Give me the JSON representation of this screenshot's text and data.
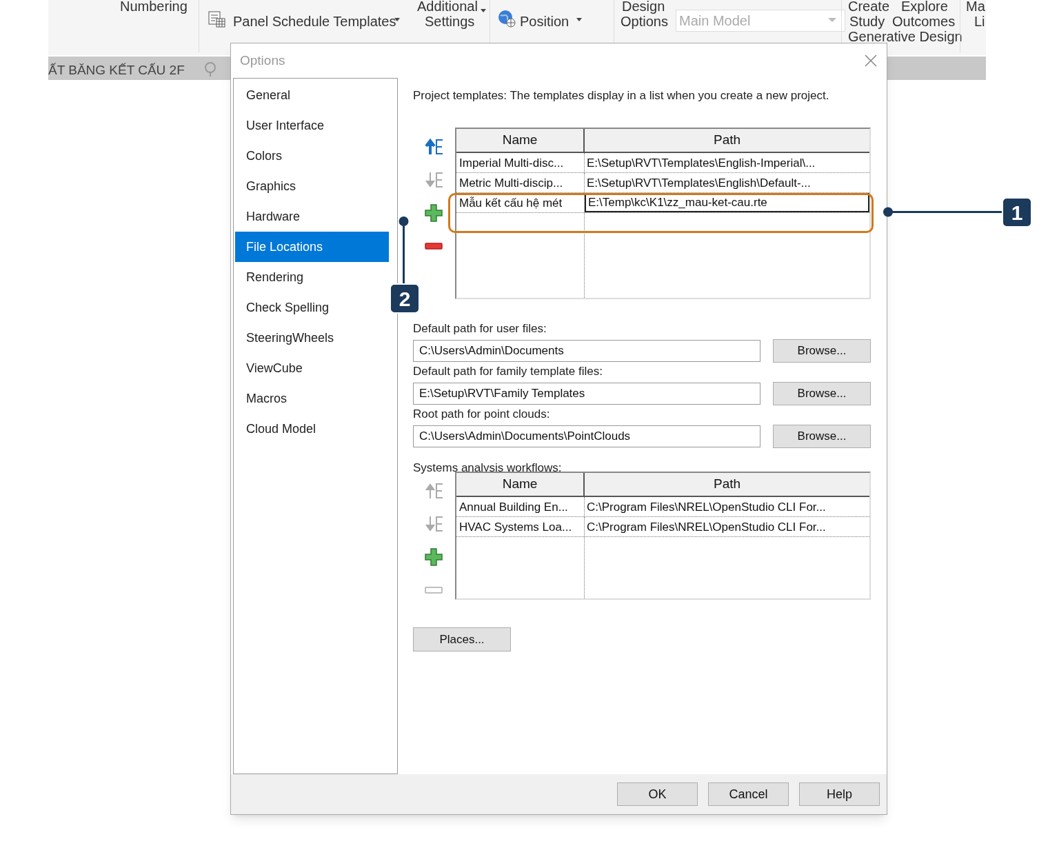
{
  "ribbon": {
    "items": [
      {
        "kind": "label",
        "text": "Numbering"
      },
      {
        "kind": "tool",
        "text": "Panel Schedule  Templates"
      },
      {
        "kind": "label",
        "text": "Additional"
      },
      {
        "kind": "label",
        "text": "Settings"
      },
      {
        "kind": "tool",
        "text": "Position"
      },
      {
        "kind": "label",
        "text": "Design"
      },
      {
        "kind": "label",
        "text": "Options"
      },
      {
        "kind": "combo",
        "text": "Main Model"
      },
      {
        "kind": "label",
        "text": "Create"
      },
      {
        "kind": "label",
        "text": "Study"
      },
      {
        "kind": "label",
        "text": "Explore"
      },
      {
        "kind": "label",
        "text": "Outcomes"
      },
      {
        "kind": "group",
        "text": "Generative Design"
      },
      {
        "kind": "label",
        "text": "Ma"
      },
      {
        "kind": "label",
        "text": "Li"
      }
    ],
    "view_tab": "ẤT BĂNG KẾT CẤU 2F"
  },
  "dialog": {
    "title": "Options",
    "nav": [
      {
        "label": "General",
        "selected": false
      },
      {
        "label": "User Interface",
        "selected": false
      },
      {
        "label": "Colors",
        "selected": false
      },
      {
        "label": "Graphics",
        "selected": false
      },
      {
        "label": "Hardware",
        "selected": false
      },
      {
        "label": "File Locations",
        "selected": true
      },
      {
        "label": "Rendering",
        "selected": false
      },
      {
        "label": "Check Spelling",
        "selected": false
      },
      {
        "label": "SteeringWheels",
        "selected": false
      },
      {
        "label": "ViewCube",
        "selected": false
      },
      {
        "label": "Macros",
        "selected": false
      },
      {
        "label": "Cloud Model",
        "selected": false
      }
    ],
    "intro": "Project templates:  The templates display in a list when you create a new project.",
    "templates": {
      "tools": [
        {
          "kind": "up",
          "disabled": false
        },
        {
          "kind": "down",
          "disabled": true
        },
        {
          "kind": "add",
          "disabled": false
        },
        {
          "kind": "remove",
          "disabled": false
        }
      ],
      "columns": [
        "Name",
        "Path"
      ],
      "rows": [
        {
          "name": "Imperial Multi-disc...",
          "path": "E:\\Setup\\RVT\\Templates\\English-Imperial\\...",
          "focused": false
        },
        {
          "name": "Metric Multi-discip...",
          "path": "E:\\Setup\\RVT\\Templates\\English\\Default-...",
          "focused": false
        },
        {
          "name": "Mẫu kết cấu hệ mét",
          "path": "E:\\Temp\\kc\\K1\\zz_mau-ket-cau.rte",
          "focused": true
        }
      ]
    },
    "paths": [
      {
        "label": "Default path for user files:",
        "value": "C:\\Users\\Admin\\Documents",
        "button": "Browse..."
      },
      {
        "label": "Default path for family template files:",
        "value": "E:\\Setup\\RVT\\Family Templates",
        "button": "Browse..."
      },
      {
        "label": "Root path for point clouds:",
        "value": "C:\\Users\\Admin\\Documents\\PointClouds",
        "button": "Browse..."
      }
    ],
    "systems": {
      "label": "Systems analysis workflows:",
      "tools": [
        {
          "kind": "up",
          "disabled": true
        },
        {
          "kind": "down",
          "disabled": true
        },
        {
          "kind": "add",
          "disabled": false
        },
        {
          "kind": "remove",
          "disabled": true
        }
      ],
      "columns": [
        "Name",
        "Path"
      ],
      "rows": [
        {
          "name": "Annual Building En...",
          "path": "C:\\Program Files\\NREL\\OpenStudio CLI For...",
          "focused": false
        },
        {
          "name": "HVAC Systems Loa...",
          "path": "C:\\Program Files\\NREL\\OpenStudio CLI For...",
          "focused": false
        }
      ]
    },
    "places_button": "Places...",
    "buttons": [
      "OK",
      "Cancel",
      "Help"
    ]
  },
  "callouts": [
    {
      "number": "1"
    },
    {
      "number": "2"
    }
  ]
}
